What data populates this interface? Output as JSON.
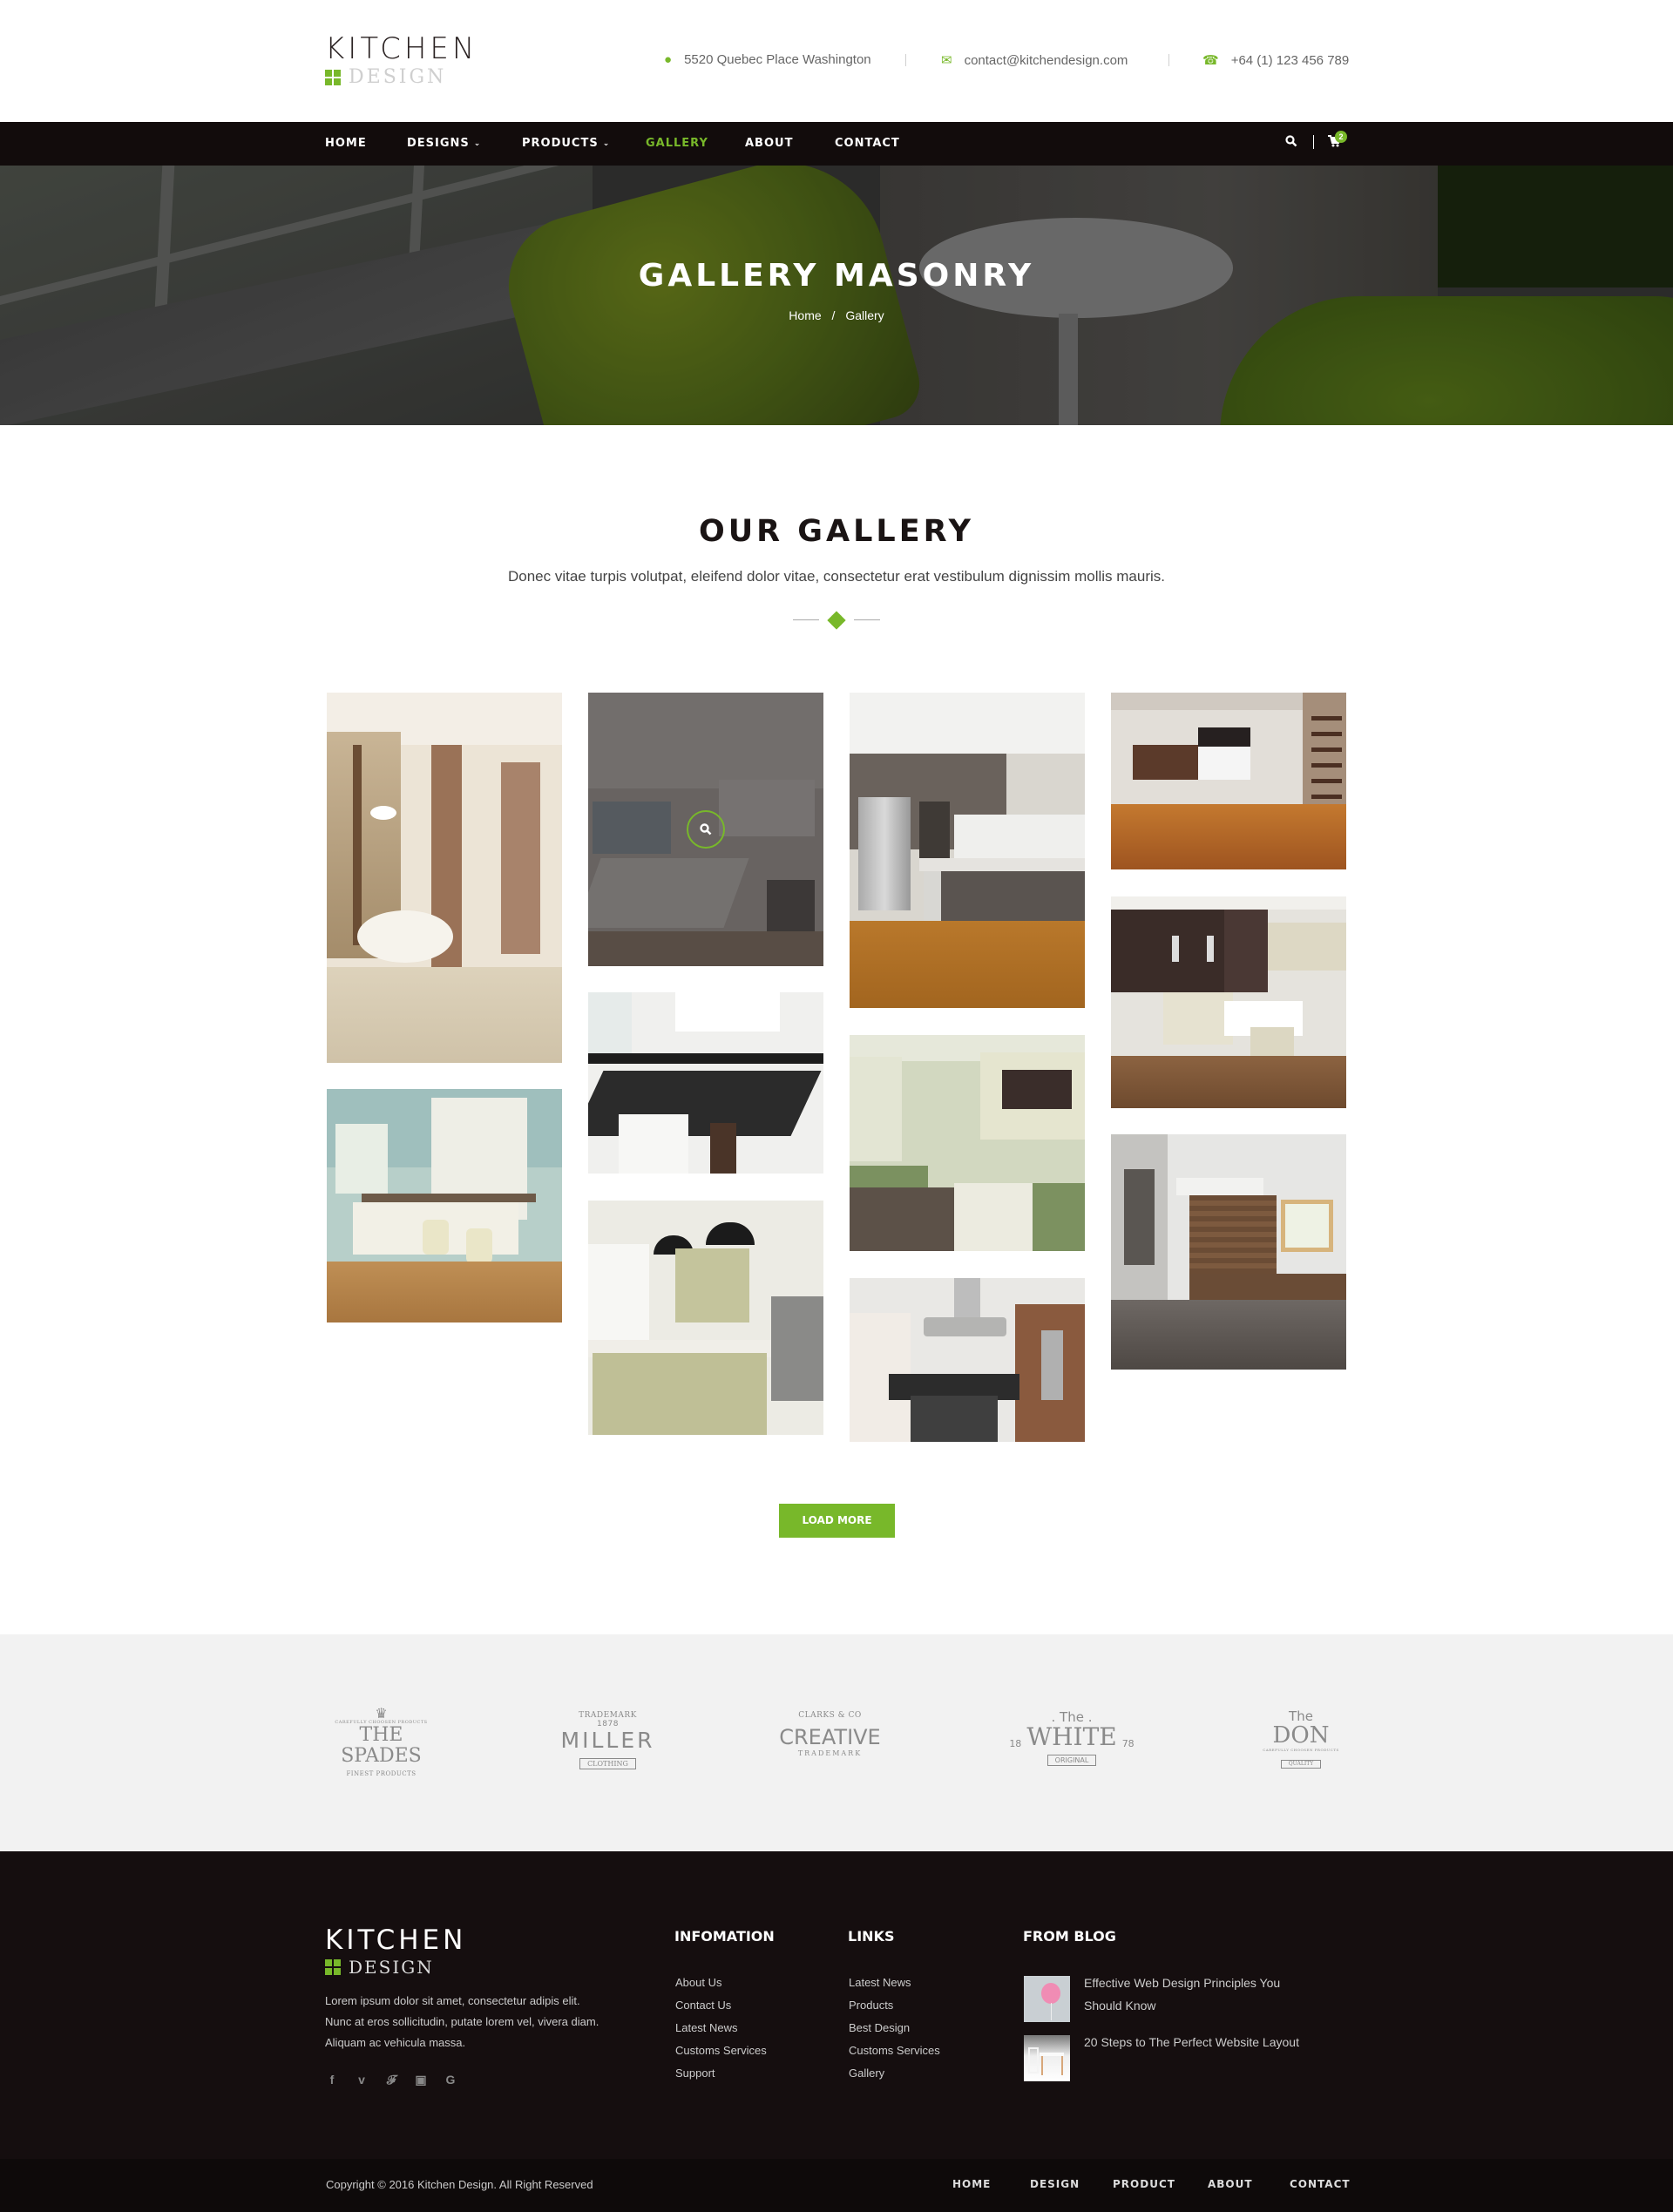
{
  "header": {
    "logo": {
      "line1": "KITCHEN",
      "line2": "DESIGN"
    },
    "contacts": [
      {
        "icon": "map-marker-icon",
        "text": "5520 Quebec Place Washington"
      },
      {
        "icon": "envelope-icon",
        "text": "contact@kitchendesign.com"
      },
      {
        "icon": "phone-icon",
        "text": "+64 (1) 123 456 789"
      }
    ]
  },
  "nav": {
    "items": [
      {
        "label": "HOME",
        "dropdown": false,
        "active": false
      },
      {
        "label": "DESIGNS",
        "dropdown": true,
        "active": false
      },
      {
        "label": "PRODUCTS",
        "dropdown": true,
        "active": false
      },
      {
        "label": "GALLERY",
        "dropdown": false,
        "active": true
      },
      {
        "label": "ABOUT",
        "dropdown": false,
        "active": false
      },
      {
        "label": "CONTACT",
        "dropdown": false,
        "active": false
      }
    ],
    "cart_count": "2"
  },
  "hero": {
    "title": "GALLERY MASONRY",
    "breadcrumb": {
      "home": "Home",
      "separator": "/",
      "current": "Gallery"
    }
  },
  "gallery": {
    "title": "OUR GALLERY",
    "subtitle": "Donec vitae turpis volutpat, eleifend dolor vitae, consectetur erat vestibulum dignissim mollis mauris.",
    "images": [
      "kitchen-dining-tree-mural",
      "kitchen-modern-island-sink",
      "kitchen-steel-fridge-island",
      "kitchen-parquet-floor",
      "kitchen-green-bar-stools",
      "kitchen-black-granite-island",
      "kitchen-green-dresser",
      "kitchen-white-island-pendant",
      "kitchen-pendant-lamps-sage",
      "kitchen-stainless-hood",
      "kitchen-wood-panels-tile"
    ],
    "load_more_label": "LOAD MORE",
    "accent_color": "#78b82a"
  },
  "brands": [
    {
      "top": "CAREFULLY CHOOSEN PRODUCTS",
      "name": "THE SPADES",
      "bottom": "FINEST PRODUCTS"
    },
    {
      "top": "TRADEMARK",
      "year": "1878",
      "name": "MILLER",
      "bottom": "CLOTHING"
    },
    {
      "top": "CLARKS & CO",
      "name": "CREATIVE",
      "bottom": "TRADEMARK"
    },
    {
      "top": ". The .",
      "left": "18",
      "name": "WHITE",
      "right": "78",
      "bottom": "ORIGINAL"
    },
    {
      "top": "The",
      "name": "DON",
      "tagline": "CAREFULLY CHOOSEN PRODUCTS",
      "bottom": "QUALITY"
    }
  ],
  "footer": {
    "logo": {
      "line1": "KITCHEN",
      "line2": "DESIGN"
    },
    "description": "Lorem ipsum dolor sit amet, consectetur adipis elit. Nunc at eros sollicitudin, putate lorem vel, vivera diam. Aliquam ac vehicula massa.",
    "socials": [
      "facebook-icon",
      "vimeo-icon",
      "twitter-icon",
      "instagram-icon",
      "google-icon"
    ],
    "information": {
      "title": "INFOMATION",
      "links": [
        "About Us",
        "Contact Us",
        "Latest News",
        "Customs Services",
        "Support"
      ]
    },
    "links": {
      "title": "LINKS",
      "links": [
        "Latest News",
        "Products",
        "Best Design",
        "Customs Services",
        "Gallery"
      ]
    },
    "blog": {
      "title": "FROM BLOG",
      "posts": [
        {
          "title": "Effective Web Design Principles You Should Know"
        },
        {
          "title": "20 Steps to The Perfect Website Layout"
        }
      ]
    }
  },
  "bottombar": {
    "copyright": "Copyright © 2016 Kitchen Design. All Right Reserved",
    "nav": [
      "HOME",
      "DESIGN",
      "PRODUCT",
      "ABOUT",
      "CONTACT"
    ]
  }
}
